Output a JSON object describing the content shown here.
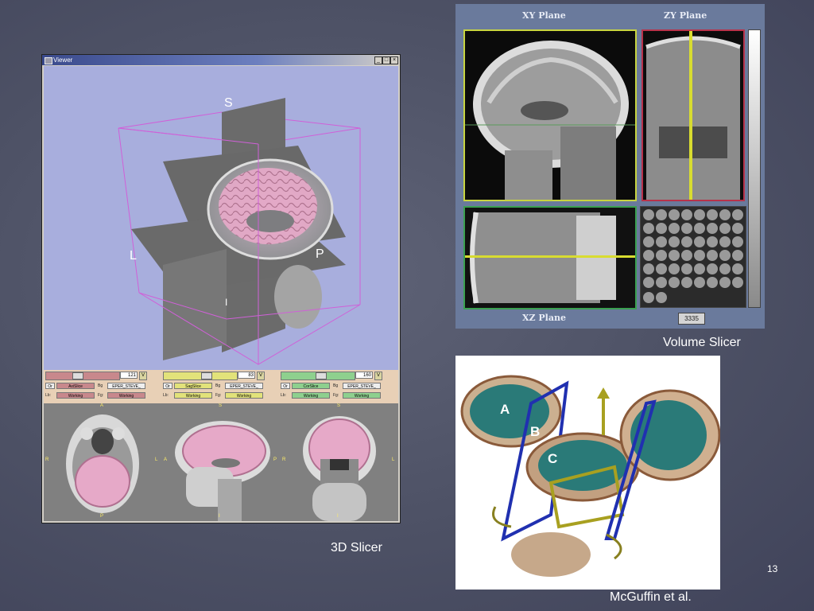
{
  "slide_number": "13",
  "captions": {
    "slicer3d": "3D Slicer",
    "volume_slicer": "Volume Slicer",
    "mcguffin": "McGuffin et al."
  },
  "viewer": {
    "title": "Viewer",
    "direction_labels": {
      "superior": "S",
      "left": "L",
      "posterior": "P",
      "inferior": "I"
    },
    "slice_controls": [
      {
        "value": "121",
        "v": "V",
        "or": "Or",
        "slice": "AxiSlice",
        "bg": "Bg",
        "volume": "EPER_STEVE_",
        "lb": "Lb:",
        "lb_val": "Working",
        "fg": "Fg:",
        "fg_val": "Working",
        "accent": "#c8888c",
        "knob_pos": 0.42
      },
      {
        "value": "83",
        "v": "V",
        "or": "Or",
        "slice": "SagSlice",
        "bg": "Bg",
        "volume": "EPER_STEVE_",
        "lb": "Lb:",
        "lb_val": "Working",
        "fg": "Fg:",
        "fg_val": "Working",
        "accent": "#e2e27a",
        "knob_pos": 0.6
      },
      {
        "value": "160",
        "v": "V",
        "or": "Or",
        "slice": "CorSlice",
        "bg": "Bg",
        "volume": "EPER_STEVE_",
        "lb": "Lb:",
        "lb_val": "Working",
        "fg": "Fg:",
        "fg_val": "Working",
        "accent": "#8ed08e",
        "knob_pos": 0.55
      }
    ],
    "thumb_labels": [
      {
        "top": "A",
        "bottom": "P",
        "left": "R",
        "right": "L"
      },
      {
        "top": "S",
        "bottom": "I",
        "left": "A",
        "right": "P"
      },
      {
        "top": "S",
        "bottom": "I",
        "left": "R",
        "right": "L"
      }
    ]
  },
  "volume_slicer": {
    "xy_title": "XY Plane",
    "zy_title": "ZY Plane",
    "xz_title": "XZ Plane",
    "counter": "3335"
  },
  "mcguffin_labels": {
    "a": "A",
    "b": "B",
    "c": "C"
  }
}
